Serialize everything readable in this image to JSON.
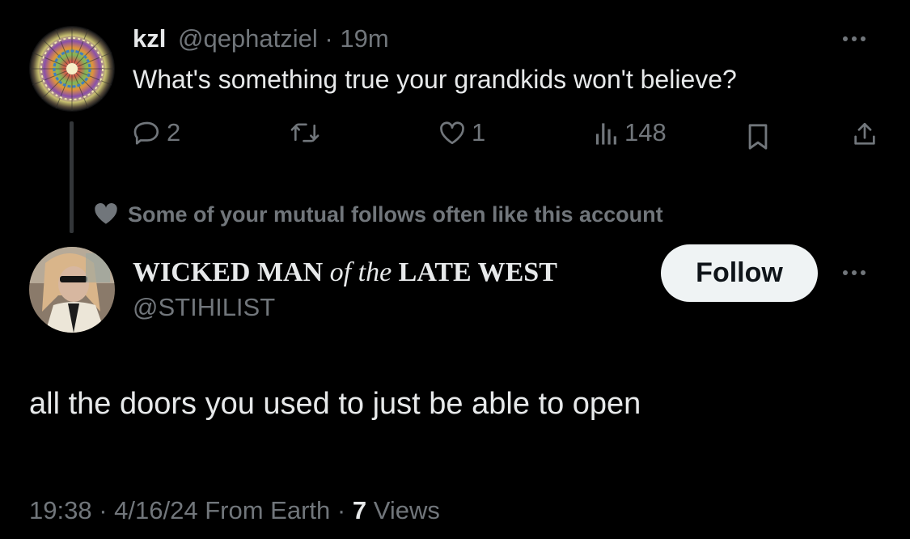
{
  "parent_tweet": {
    "display_name": "kzl",
    "handle": "@qephatziel",
    "separator": "·",
    "time": "19m",
    "text": "What's something true your grandkids won't believe?",
    "replies": "2",
    "likes": "1",
    "views": "148"
  },
  "social_context": "Some of your mutual follows often like this account",
  "reply_tweet": {
    "name_part1": "WICKED MAN",
    "name_part2": "of the",
    "name_part3": "LATE WEST",
    "handle": "@STIHILIST",
    "follow_label": "Follow",
    "text": "all the doors you used to just be able to open",
    "meta": {
      "time": "19:38",
      "separator1": "·",
      "date": "4/16/24",
      "source": "From Earth",
      "separator2": "·",
      "views_count": "7",
      "views_label": "Views"
    }
  },
  "icons": [
    "reply-icon",
    "retweet-icon",
    "like-icon",
    "views-icon",
    "bookmark-icon",
    "share-icon",
    "more-icon",
    "heart-icon"
  ],
  "colors": {
    "background": "#000000",
    "text": "#e7e9ea",
    "secondary": "#71767b",
    "follow_bg": "#eff3f4"
  }
}
